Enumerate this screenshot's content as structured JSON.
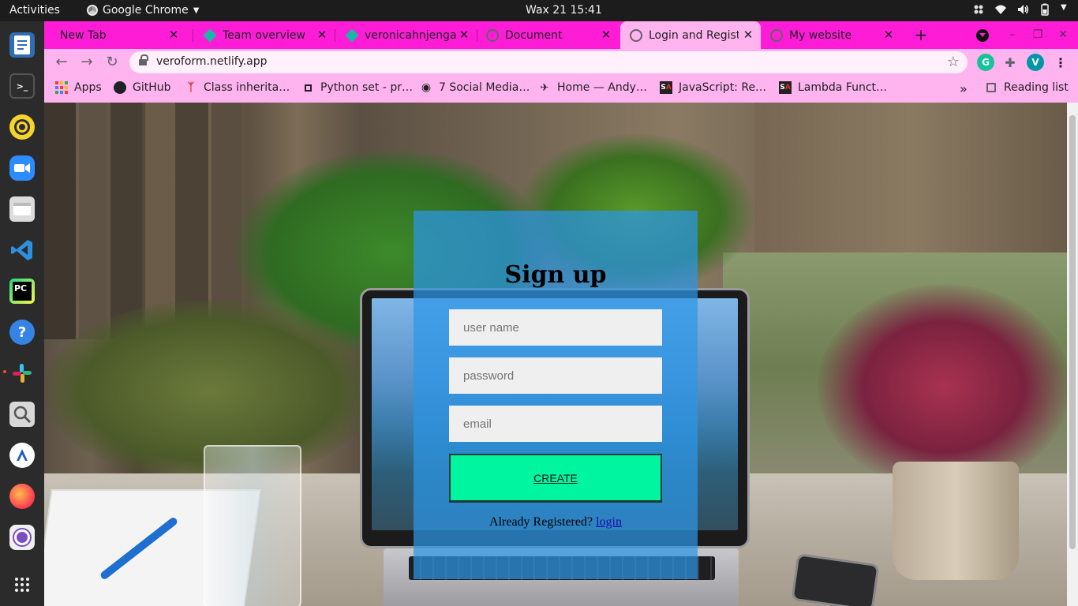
{
  "system": {
    "activities": "Activities",
    "app_name": "Google Chrome",
    "clock": "Wax 21  15:41"
  },
  "dock": {
    "apps": [
      {
        "name": "text-editor",
        "label": ""
      },
      {
        "name": "terminal",
        "label": ">_"
      },
      {
        "name": "rhythmbox",
        "label": ""
      },
      {
        "name": "zoom",
        "label": ""
      },
      {
        "name": "files",
        "label": ""
      },
      {
        "name": "vscode",
        "label": ""
      },
      {
        "name": "pycharm",
        "label": "PC"
      },
      {
        "name": "help",
        "label": "?"
      },
      {
        "name": "slack",
        "label": ""
      },
      {
        "name": "screenshot",
        "label": ""
      },
      {
        "name": "app-store",
        "label": ""
      },
      {
        "name": "firefox",
        "label": ""
      },
      {
        "name": "obs",
        "label": ""
      },
      {
        "name": "show-apps",
        "label": ""
      }
    ]
  },
  "tabs": [
    {
      "title": "New Tab",
      "icon": "none",
      "active": false
    },
    {
      "title": "Team overview |",
      "icon": "diamond-icon",
      "active": false
    },
    {
      "title": "veronicahnjenga",
      "icon": "diamond-icon",
      "active": false
    },
    {
      "title": "Document",
      "icon": "globe-icon",
      "active": false
    },
    {
      "title": "Login and Regist",
      "icon": "globe-icon",
      "active": true
    },
    {
      "title": "My website",
      "icon": "globe-icon",
      "active": false
    }
  ],
  "address_bar": {
    "url": "veroform.netlify.app"
  },
  "profile": {
    "initial": "V"
  },
  "extensions": {
    "grammarly": "G"
  },
  "bookmarks": [
    {
      "label": "Apps",
      "icon": "apps-grid-icon"
    },
    {
      "label": "GitHub",
      "icon": "github-icon"
    },
    {
      "label": "Class inherita…",
      "icon": "figure-icon"
    },
    {
      "label": "Python set - pr…",
      "icon": "square-icon"
    },
    {
      "label": "7 Social Media…",
      "icon": "signal-icon"
    },
    {
      "label": "Home — Andy…",
      "icon": "plane-icon"
    },
    {
      "label": "JavaScript: Re…",
      "icon": "sa-icon"
    },
    {
      "label": "Lambda Funct…",
      "icon": "sa-icon"
    }
  ],
  "reading_list": "Reading list",
  "form": {
    "title": "Sign up",
    "username_placeholder": "user name",
    "password_placeholder": "password",
    "email_placeholder": "email",
    "create_label": "CREATE",
    "already_text": "Already Registered?",
    "login_link": "login"
  },
  "colors": {
    "tab_strip": "#ff1cd7",
    "toolbar": "#ffb3ef",
    "card": "rgba(44,150,230,0.72)",
    "create_button": "#00f5a0"
  }
}
